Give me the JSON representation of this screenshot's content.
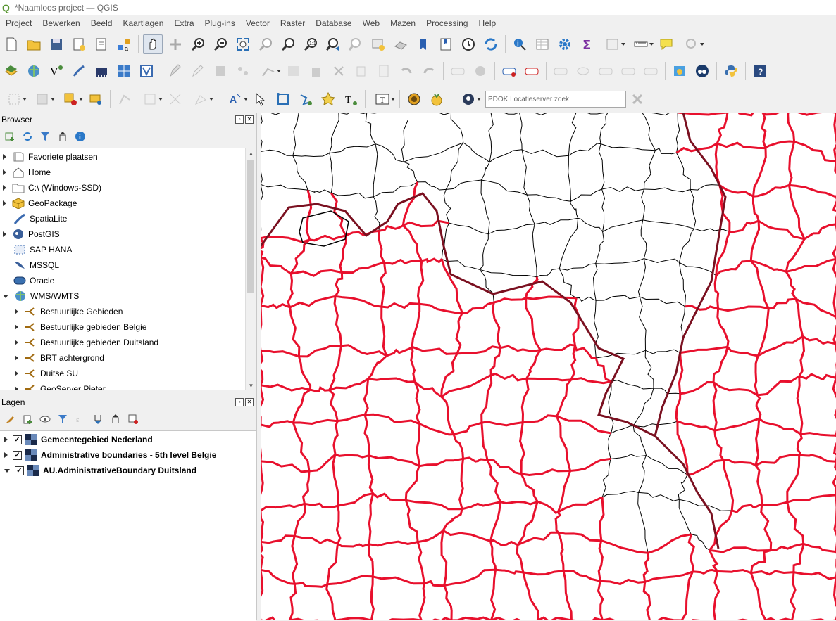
{
  "window": {
    "title": "*Naamloos project — QGIS"
  },
  "menu": [
    "Project",
    "Bewerken",
    "Beeld",
    "Kaartlagen",
    "Extra",
    "Plug-ins",
    "Vector",
    "Raster",
    "Database",
    "Web",
    "Mazen",
    "Processing",
    "Help"
  ],
  "locator": {
    "placeholder": "PDOK Locatieserver zoek"
  },
  "browser": {
    "title": "Browser",
    "items": [
      {
        "label": "Favoriete plaatsen",
        "icon": "star-folder-icon"
      },
      {
        "label": "Home",
        "icon": "home-icon"
      },
      {
        "label": "C:\\ (Windows-SSD)",
        "icon": "drive-icon"
      },
      {
        "label": "GeoPackage",
        "icon": "geopackage-icon"
      },
      {
        "label": "SpatiaLite",
        "icon": "spatialite-icon"
      },
      {
        "label": "PostGIS",
        "icon": "postgis-icon"
      },
      {
        "label": "SAP HANA",
        "icon": "sap-hana-icon"
      },
      {
        "label": "MSSQL",
        "icon": "mssql-icon"
      },
      {
        "label": "Oracle",
        "icon": "oracle-icon"
      },
      {
        "label": "WMS/WMTS",
        "icon": "wms-icon"
      }
    ],
    "wms_children": [
      "Bestuurlijke Gebieden",
      "Bestuurlijke gebieden Belgie",
      "Bestuurlijke gebieden Duitsland",
      "BRT achtergrond",
      "Duitse SU",
      "GeoServer Pieter"
    ]
  },
  "layers": {
    "title": "Lagen",
    "items": [
      {
        "label": "Gemeentegebied Nederland",
        "checked": true
      },
      {
        "label": "Administrative boundaries - 5th level Belgie",
        "checked": true
      },
      {
        "label": "AU.AdministrativeBoundary Duitsland",
        "checked": true
      }
    ]
  },
  "colors": {
    "red_boundary": "#e8102d",
    "black_boundary": "#000000",
    "dark_boundary": "#7a1020"
  }
}
